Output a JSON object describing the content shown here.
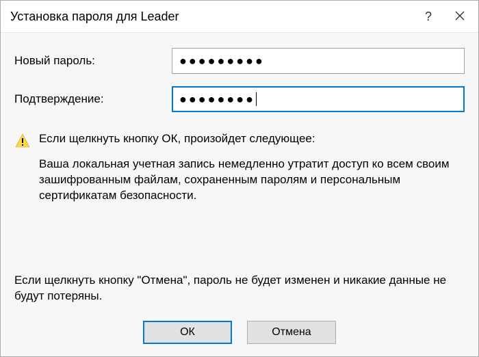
{
  "titlebar": {
    "title": "Установка пароля для Leader",
    "help": "?",
    "close": "✕"
  },
  "form": {
    "new_password_label": "Новый пароль:",
    "confirm_label": "Подтверждение:",
    "new_password_value": "●●●●●●●●●",
    "confirm_value": "●●●●●●●●"
  },
  "warning": {
    "heading": "Если щелкнуть кнопку ОК, произойдет следующее:",
    "body": "Ваша локальная учетная запись немедленно утратит доступ ко всем своим зашифрованным файлам, сохраненным паролям и персональным сертификатам безопасности."
  },
  "cancel_info": "Если щелкнуть кнопку \"Отмена\", пароль не будет изменен и никакие данные не будут потеряны.",
  "buttons": {
    "ok": "ОК",
    "cancel": "Отмена"
  }
}
